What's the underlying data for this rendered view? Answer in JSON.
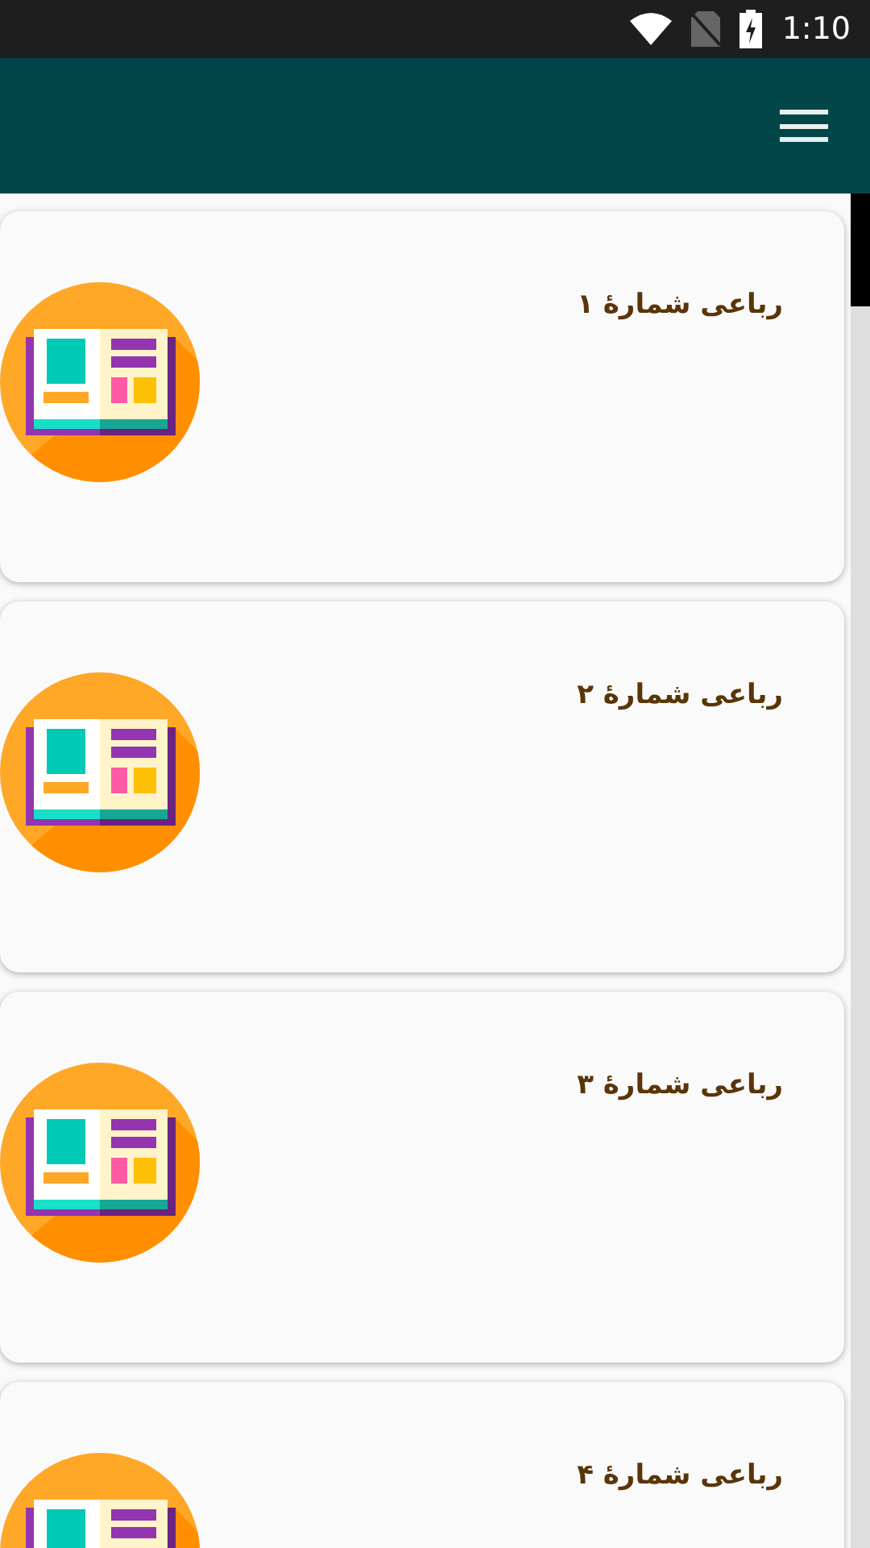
{
  "status_bar": {
    "time": "1:10"
  },
  "cards": [
    {
      "title": "رباعی شمارهٔ ۱"
    },
    {
      "title": "رباعی شمارهٔ ۲"
    },
    {
      "title": "رباعی شمارهٔ ۳"
    },
    {
      "title": "رباعی شمارهٔ ۴"
    }
  ]
}
